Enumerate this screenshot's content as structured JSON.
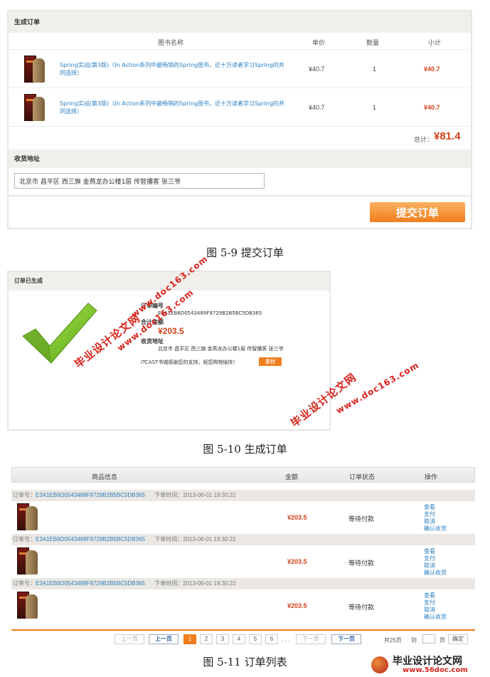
{
  "fig1": {
    "header": "生成订单",
    "col_name": "图书名称",
    "col_price": "单价",
    "col_qty": "数量",
    "col_subtotal": "小计",
    "items": [
      {
        "title": "Spring实战(第3版)（In Action系列中最畅销的Spring图书，近十万读者学习Spring的共同选择）",
        "price": "¥40.7",
        "qty": "1",
        "subtotal": "¥40.7"
      },
      {
        "title": "Spring实战(第3版)（In Action系列中最畅销的Spring图书，近十万读者学习Spring的共同选择）",
        "price": "¥40.7",
        "qty": "1",
        "subtotal": "¥40.7"
      }
    ],
    "total_label": "总计：",
    "total_value": "¥81.4",
    "address_header": "收货地址",
    "address_value": "北京市 昌平区 西三旗 金燕龙办公楼1层 传智播客 张三爷",
    "submit_label": "提交订单",
    "caption": "图  5-9  提交订单"
  },
  "fig2": {
    "header": "订单已生成",
    "order_no_label": "订单编号",
    "order_no": "E3A1EB6D0543489F9729B2B5BC5DB365",
    "total_label": "合计金额",
    "total_value": "¥203.5",
    "address_label": "收货地址",
    "address_value": "北京市 昌平区 西三旗 金燕龙办公楼1层 传智播客 张三爷",
    "thanks": "ITCAST书城感谢您的支持，祝您购物愉快！",
    "pay_label": "支付",
    "caption": "图  5-10  生成订单"
  },
  "fig3": {
    "col_info": "商品信息",
    "col_amount": "金额",
    "col_status": "订单状态",
    "col_ops": "操作",
    "orders": [
      {
        "no_label": "订单号：",
        "no": "E3A1EB6D0543489F9729B2B5BC5DB365",
        "time_label": "下单时间：",
        "time": "2013-06-01 19:30:22",
        "amount": "¥203.5",
        "status": "等待付款"
      },
      {
        "no_label": "订单号：",
        "no": "E3A1EB6D0543489F9729B2B5BC5DB365",
        "time_label": "下单时间：",
        "time": "2013-06-01 19:30:22",
        "amount": "¥203.5",
        "status": "等待付款"
      },
      {
        "no_label": "订单号：",
        "no": "E3A1EB6D0543489F9729B2B5BC5DB365",
        "time_label": "下单时间：",
        "time": "2013-06-01 19:30:22",
        "amount": "¥203.5",
        "status": "等待付款"
      }
    ],
    "ops": {
      "view": "查看",
      "pay": "支付",
      "cancel": "取消",
      "confirm": "确认收货"
    },
    "pager": {
      "first": "上一页",
      "prev": "上一页",
      "pages": [
        "1",
        "2",
        "3",
        "4",
        "5",
        "6"
      ],
      "ellipsis": ". . .",
      "next_disabled": "下一页",
      "next": "下一页",
      "total": "共25页",
      "goto": "到",
      "page_unit": "页",
      "confirm": "确定"
    },
    "caption": "图  5-11  订单列表"
  },
  "watermarks": {
    "site_a": "www.doc163.com",
    "site_b": "毕业设计论文网"
  },
  "footer_logo": {
    "name": "毕业设计论文网",
    "url": "www.56doc.com"
  }
}
